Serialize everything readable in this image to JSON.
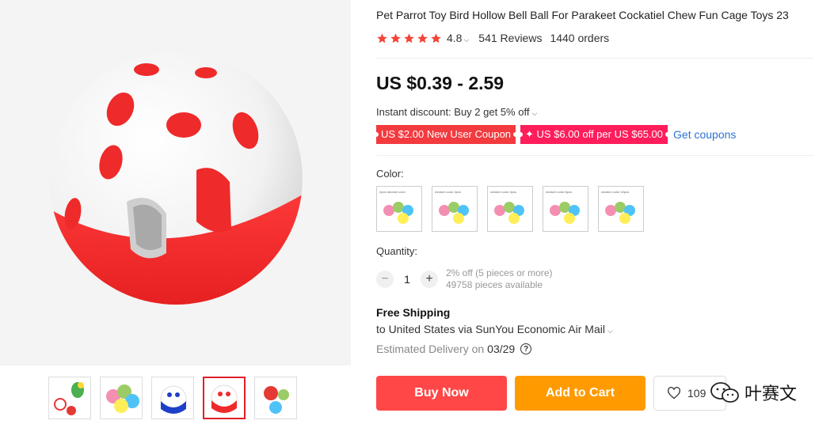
{
  "product": {
    "title": "Pet Parrot Toy Bird Hollow Bell Ball For Parakeet Cockatiel Chew Fun Cage Toys 23",
    "rating": "4.8",
    "stars": 5,
    "reviews": "541 Reviews",
    "orders": "1440 orders",
    "price": "US $0.39 - 2.59",
    "instant_discount": "Instant discount: Buy 2 get 5% off"
  },
  "coupons": [
    {
      "label": "US $2.00 New User Coupon"
    },
    {
      "label": "✦ US $6.00 off per US $65.00"
    }
  ],
  "get_coupons": "Get coupons",
  "color": {
    "label": "Color:",
    "options": [
      {
        "label": "2pcs random color"
      },
      {
        "label": "random color 2pcs"
      },
      {
        "label": "random color 4pcs"
      },
      {
        "label": "random color 6pcs"
      },
      {
        "label": "random color 10pcs"
      }
    ]
  },
  "quantity": {
    "label": "Quantity:",
    "value": "1",
    "discount_note": "2% off (5 pieces or more)",
    "available": "49758 pieces available"
  },
  "shipping": {
    "title": "Free Shipping",
    "detail": "to United States via SunYou Economic Air Mail",
    "delivery_label": "Estimated Delivery on",
    "delivery_date": "03/29"
  },
  "actions": {
    "buy_now": "Buy Now",
    "add_to_cart": "Add to Cart",
    "wishlist_count": "109"
  },
  "watermark": "叶赛文",
  "colors": {
    "accent_red": "#ff4747",
    "accent_orange": "#ff9a00",
    "link_blue": "#2e72d2",
    "star": "#f44336"
  },
  "gallery": {
    "thumbnail_count": 5,
    "active_index": 3
  }
}
